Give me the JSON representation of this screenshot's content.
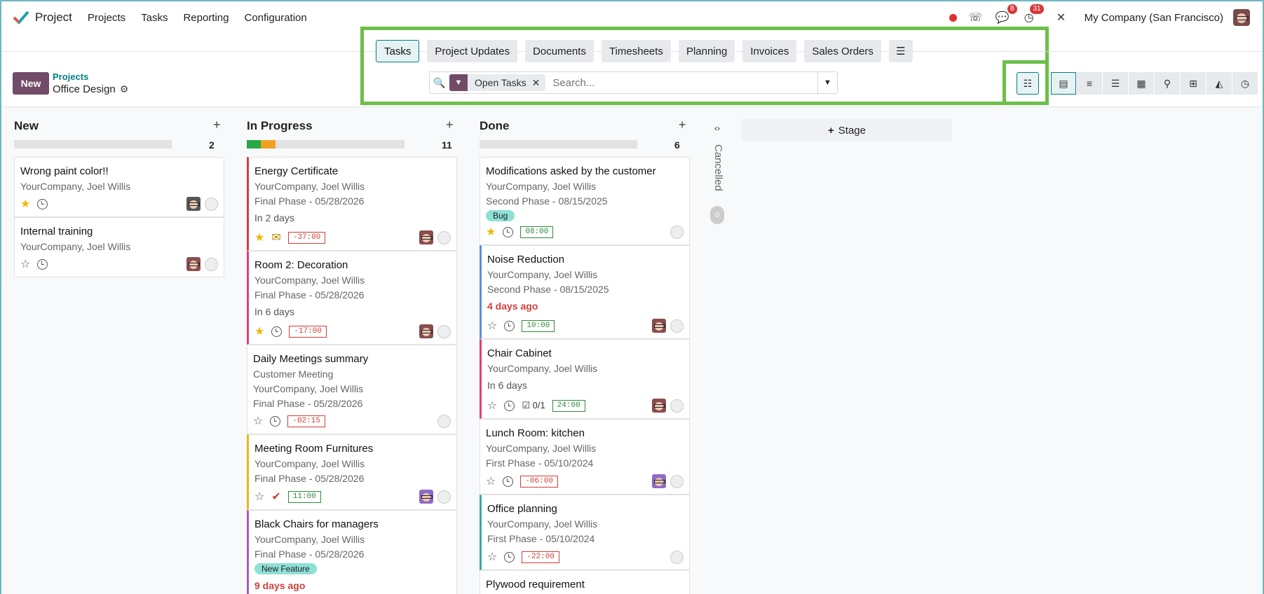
{
  "app": {
    "name": "Project"
  },
  "nav": {
    "menu": [
      "Projects",
      "Tasks",
      "Reporting",
      "Configuration"
    ],
    "messages_count": "8",
    "activities_count": "31",
    "company": "My Company (San Francisco)"
  },
  "control": {
    "new_label": "New",
    "breadcrumb_parent": "Projects",
    "breadcrumb_current": "Office Design"
  },
  "tabs": [
    "Tasks",
    "Project Updates",
    "Documents",
    "Timesheets",
    "Planning",
    "Invoices",
    "Sales Orders"
  ],
  "search": {
    "facet": "Open Tasks",
    "placeholder": "Search..."
  },
  "colors": {
    "accent": "#714b67",
    "teal": "#017e84",
    "highlight": "#6cbf4a"
  },
  "columns": [
    {
      "title": "New",
      "count": "2",
      "cards": [
        {
          "title": "Wrong paint color!!",
          "lines": [
            "YourCompany, Joel Willis"
          ],
          "starred": true,
          "avatar": "dark"
        },
        {
          "title": "Internal training",
          "lines": [
            "YourCompany, Joel Willis"
          ],
          "starred": false,
          "avatar": "default"
        }
      ]
    },
    {
      "title": "In Progress",
      "count": "11",
      "progress": [
        {
          "color": "#28a745",
          "fraction": 0.09
        },
        {
          "color": "#f0a020",
          "fraction": 0.09
        }
      ],
      "cards": [
        {
          "title": "Energy Certificate",
          "lines": [
            "YourCompany, Joel Willis",
            "Final Phase - 05/28/2026"
          ],
          "due": "In 2 days",
          "starred": true,
          "mail": true,
          "time": "-37:00",
          "time_color": "red",
          "avatar": "default",
          "border": "#d23f3a"
        },
        {
          "title": "Room 2: Decoration",
          "lines": [
            "YourCompany, Joel Willis",
            "Final Phase - 05/28/2026"
          ],
          "due": "In 6 days",
          "starred": true,
          "time": "-17:00",
          "time_color": "red",
          "avatar": "default",
          "border": "#e0407b"
        },
        {
          "title": "Daily Meetings summary",
          "lines": [
            "Customer Meeting",
            "YourCompany, Joel Willis",
            "Final Phase - 05/28/2026"
          ],
          "starred": false,
          "time": "-02:15",
          "time_color": "red",
          "avatar": "none"
        },
        {
          "title": "Meeting Room Furnitures",
          "lines": [
            "YourCompany, Joel Willis",
            "Final Phase - 05/28/2026"
          ],
          "starred": false,
          "check": true,
          "time": "11:00",
          "time_color": "green",
          "avatar": "purple",
          "border": "#e8b81c"
        },
        {
          "title": "Black Chairs for managers",
          "lines": [
            "YourCompany, Joel Willis",
            "Final Phase - 05/28/2026"
          ],
          "tag": "New Feature",
          "tag_color": "#8ee0d6",
          "due": "9 days ago",
          "due_red": true,
          "border": "#a65fb3"
        }
      ]
    },
    {
      "title": "Done",
      "count": "6",
      "cards": [
        {
          "title": "Modifications asked by the customer",
          "lines": [
            "YourCompany, Joel Willis",
            "Second Phase - 08/15/2025"
          ],
          "tag": "Bug",
          "tag_color": "#8ee0d6",
          "starred": true,
          "time": "08:00",
          "time_color": "green",
          "avatar": "none"
        },
        {
          "title": "Noise Reduction",
          "lines": [
            "YourCompany, Joel Willis",
            "Second Phase - 08/15/2025"
          ],
          "due": "4 days ago",
          "due_red": true,
          "starred": false,
          "time": "10:00",
          "time_color": "green",
          "avatar": "default",
          "border": "#5b8fd9"
        },
        {
          "title": "Chair Cabinet",
          "lines": [
            "YourCompany, Joel Willis"
          ],
          "due": "In 6 days",
          "starred": false,
          "subtasks": "0/1",
          "time": "24:00",
          "time_color": "green",
          "avatar": "default",
          "border": "#e0407b"
        },
        {
          "title": "Lunch Room: kitchen",
          "lines": [
            "YourCompany, Joel Willis",
            "First Phase - 05/10/2024"
          ],
          "starred": false,
          "time": "-06:00",
          "time_color": "red",
          "avatar": "purple"
        },
        {
          "title": "Office planning",
          "lines": [
            "YourCompany, Joel Willis",
            "First Phase - 05/10/2024"
          ],
          "starred": false,
          "time": "-22:00",
          "time_color": "red",
          "avatar": "none",
          "border": "#3aa99f"
        },
        {
          "title": "Plywood requirement",
          "lines": []
        }
      ]
    }
  ],
  "folded": {
    "label": "Cancelled",
    "count": "0"
  },
  "add_stage_label": "Stage"
}
